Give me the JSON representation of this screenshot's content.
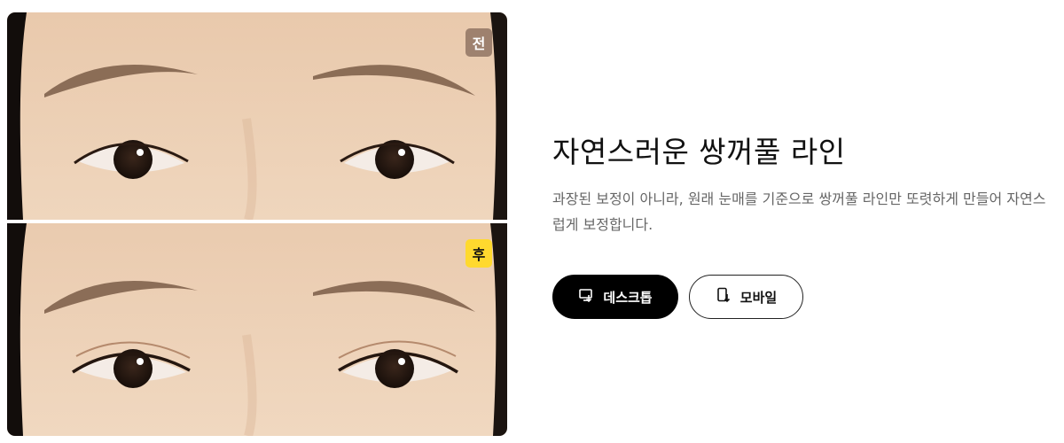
{
  "comparison": {
    "before_label": "전",
    "after_label": "후",
    "before_image_alt": "eyes-before",
    "after_image_alt": "eyes-after"
  },
  "feature": {
    "title": "자연스러운 쌍꺼풀 라인",
    "description": "과장된 보정이 아니라, 원래 눈매를 기준으로 쌍꺼풀 라인만 또렷하게 만들어 자연스럽게 보정합니다."
  },
  "actions": {
    "desktop_label": "데스크톱",
    "mobile_label": "모바일",
    "desktop_icon": "desktop-download-icon",
    "mobile_icon": "mobile-download-icon"
  },
  "colors": {
    "after_badge": "#ffd92e",
    "primary_button": "#000000"
  }
}
